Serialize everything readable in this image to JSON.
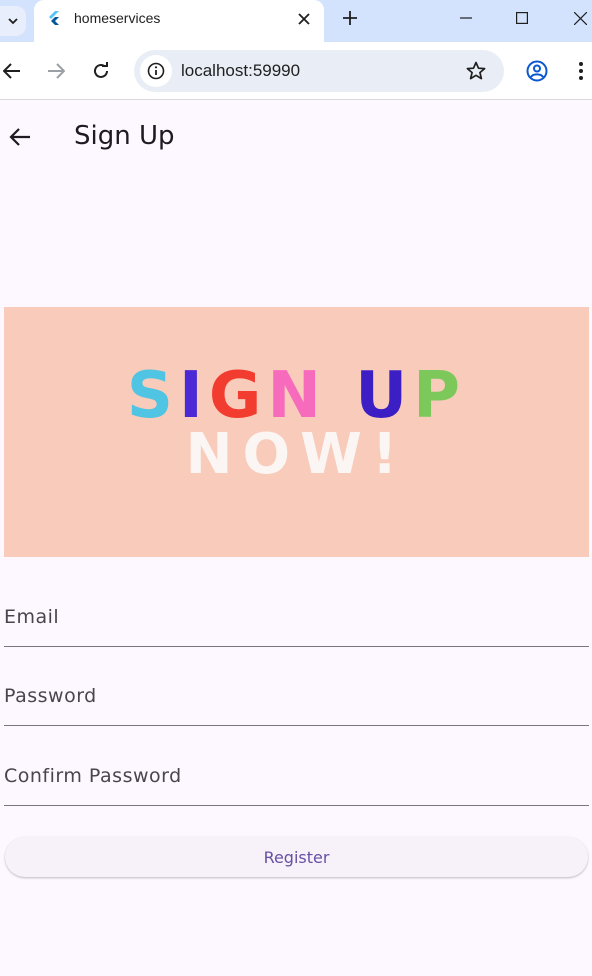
{
  "browser": {
    "tab_title": "homeservices",
    "url": "localhost:59990"
  },
  "appbar": {
    "title": "Sign Up"
  },
  "banner": {
    "line1_letters": [
      {
        "ch": "S",
        "color": "#4fc4e3"
      },
      {
        "ch": "I",
        "color": "#4b2ad6"
      },
      {
        "ch": "G",
        "color": "#f23c30"
      },
      {
        "ch": "N",
        "color": "#f76bbd"
      },
      {
        "ch": " ",
        "color": "#000000"
      },
      {
        "ch": "U",
        "color": "#3b1fc4"
      },
      {
        "ch": "P",
        "color": "#7cc85a"
      }
    ],
    "line2": "NOW!",
    "background": "#f9cbbb"
  },
  "form": {
    "email_placeholder": "Email",
    "password_placeholder": "Password",
    "confirm_placeholder": "Confirm Password",
    "register_label": "Register"
  },
  "colors": {
    "page_background": "#fdf7ff",
    "accent": "#6750a4"
  }
}
